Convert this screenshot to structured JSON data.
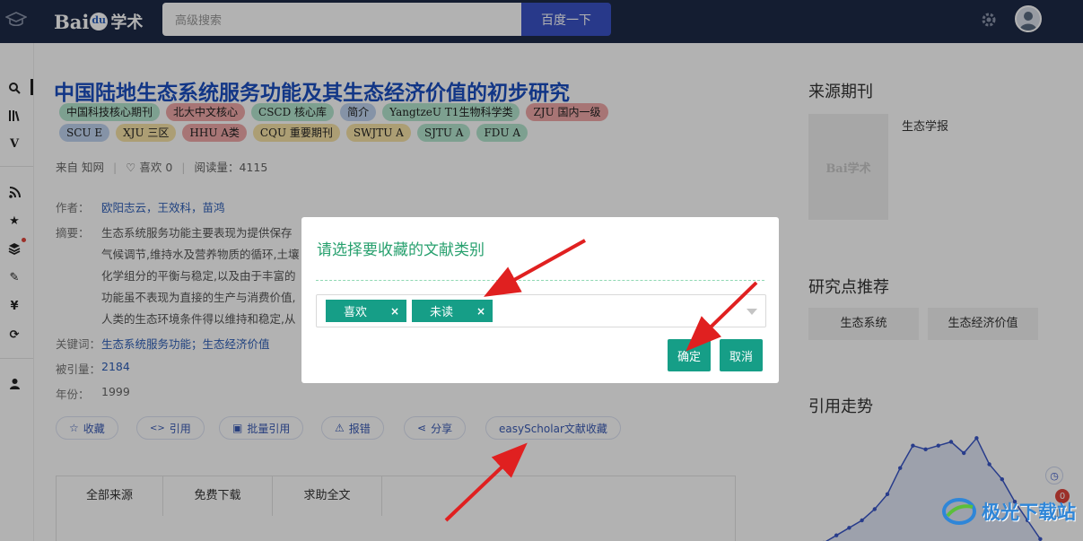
{
  "header": {
    "logo_text_a": "Bai",
    "logo_text_b": "学术",
    "search_placeholder": "高级搜索",
    "search_button": "百度一下"
  },
  "paper": {
    "title": "中国陆地生态系统服务功能及其生态经济价值的初步研究",
    "tags": [
      {
        "label": "中国科技核心期刊",
        "color": "green"
      },
      {
        "label": "北大中文核心",
        "color": "red"
      },
      {
        "label": "CSCD 核心库",
        "color": "green"
      },
      {
        "label": "简介",
        "color": "blue"
      },
      {
        "label": "YangtzeU T1生物科学类",
        "color": "green"
      },
      {
        "label": "ZJU 国内一级",
        "color": "red"
      },
      {
        "label": "SCU E",
        "color": "blue"
      },
      {
        "label": "XJU 三区",
        "color": "yellow"
      },
      {
        "label": "HHU A类",
        "color": "red"
      },
      {
        "label": "CQU 重要期刊",
        "color": "yellow"
      },
      {
        "label": "SWJTU A",
        "color": "yellow"
      },
      {
        "label": "SJTU A",
        "color": "green"
      },
      {
        "label": "FDU A",
        "color": "green"
      }
    ],
    "source": "来自 知网",
    "likes": "喜欢 0",
    "reads": "阅读量：4115",
    "authors_label": "作者：",
    "authors": "欧阳志云，王效科，苗鸿",
    "abstract_label": "摘要：",
    "abstract_lines": [
      "生态系统服务功能主要表现为提供保存",
      "气候调节,维持水及营养物质的循环,土壤",
      "化学组分的平衡与稳定,以及由于丰富的",
      "功能虽不表现为直接的生产与消费价值,",
      "人类的生态环境条件得以维持和稳定,从"
    ],
    "keywords_label": "关键词：",
    "keywords": "生态系统服务功能；生态经济价值",
    "cited_label": "被引量：",
    "cited": "2184",
    "year_label": "年份：",
    "year": "1999"
  },
  "actions": [
    "收藏",
    "引用",
    "批量引用",
    "报错",
    "分享",
    "easyScholar文献收藏"
  ],
  "tabs": [
    "全部来源",
    "免费下载",
    "求助全文"
  ],
  "right": {
    "source_heading": "来源期刊",
    "journal_name": "生态学报",
    "cover_text": "Bai学术",
    "research_heading": "研究点推荐",
    "research_tags": [
      "生态系统",
      "生态经济价值"
    ],
    "trend_heading": "引用走势",
    "notification_count": "0"
  },
  "watermark": "极光下载站",
  "modal": {
    "title": "请选择要收藏的文献类别",
    "chips": [
      "喜欢",
      "未读"
    ],
    "chip_remove": "×",
    "confirm": "确定",
    "cancel": "取消"
  },
  "colors": {
    "topbar": "#1e2a47",
    "search_button": "#3a52c6",
    "title_link": "#1a4ec0",
    "modal_accent": "#169e87",
    "annotation_arrow": "#e02020"
  },
  "chart_data": {
    "type": "line",
    "title": "引用走势",
    "series": [
      {
        "values": [
          0,
          2,
          4,
          6,
          9,
          13,
          20,
          26,
          25,
          26,
          27,
          24,
          28,
          21,
          17,
          11,
          6,
          1
        ]
      }
    ]
  }
}
